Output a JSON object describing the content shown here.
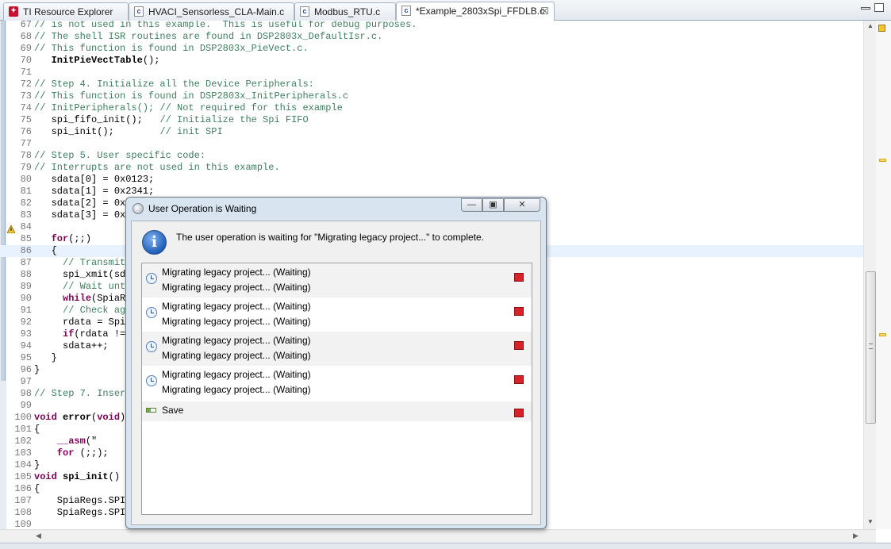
{
  "tabs": [
    {
      "icon": "ti-resource-explorer-icon",
      "label": "TI Resource Explorer"
    },
    {
      "icon": "c-file-icon",
      "label": "HVACI_Sensorless_CLA-Main.c"
    },
    {
      "icon": "c-file-icon",
      "label": "Modbus_RTU.c"
    },
    {
      "icon": "c-file-icon",
      "label": "*Example_2803xSpi_FFDLB.c",
      "active": true,
      "close": "☒"
    }
  ],
  "code_lines": [
    {
      "n": "67",
      "html": "<span class=\"c-com\">// is not used in this example.  This is useful for debug purposes.</span>"
    },
    {
      "n": "68",
      "html": "<span class=\"c-com\">// The shell ISR routines are found in DSP2803x_DefaultIsr.c.</span>"
    },
    {
      "n": "69",
      "html": "<span class=\"c-com\">// This function is found in DSP2803x_PieVect.c.</span>"
    },
    {
      "n": "70",
      "html": "   <span class=\"c-fn\">InitPieVectTable</span>();"
    },
    {
      "n": "71",
      "html": ""
    },
    {
      "n": "72",
      "html": "<span class=\"c-com\">// Step 4. Initialize all the Device Peripherals:</span>"
    },
    {
      "n": "73",
      "html": "<span class=\"c-com\">// This function is found in DSP2803x_InitPeripherals.c</span>"
    },
    {
      "n": "74",
      "html": "<span class=\"c-com\">// InitPeripherals(); // Not required for this example</span>"
    },
    {
      "n": "75",
      "html": "   spi_fifo_init();   <span class=\"c-com\">// Initialize the Spi FIFO</span>"
    },
    {
      "n": "76",
      "html": "   spi_init();        <span class=\"c-com\">// init SPI</span>"
    },
    {
      "n": "77",
      "html": ""
    },
    {
      "n": "78",
      "html": "<span class=\"c-com\">// Step 5. User specific code:</span>"
    },
    {
      "n": "79",
      "html": "<span class=\"c-com\">// Interrupts are not used in this example.</span>"
    },
    {
      "n": "80",
      "html": "   sdata[0] = 0x0123;"
    },
    {
      "n": "81",
      "html": "   sdata[1] = 0x2341;"
    },
    {
      "n": "82",
      "html": "   sdata[2] = 0x"
    },
    {
      "n": "83",
      "html": "   sdata[3] = 0x"
    },
    {
      "n": "84",
      "html": ""
    },
    {
      "n": "85",
      "html": "   <span class=\"c-kw\">for</span>(;;)"
    },
    {
      "n": "86",
      "html": "   {",
      "hl": true
    },
    {
      "n": "87",
      "html": "     <span class=\"c-com\">// Transmit</span>"
    },
    {
      "n": "88",
      "html": "     spi_xmit(sda"
    },
    {
      "n": "89",
      "html": "     <span class=\"c-com\">// Wait unti</span>"
    },
    {
      "n": "90",
      "html": "     <span class=\"c-kw\">while</span>(SpiaRe"
    },
    {
      "n": "91",
      "html": "     <span class=\"c-com\">// Check aga</span>"
    },
    {
      "n": "92",
      "html": "     rdata = Spia"
    },
    {
      "n": "93",
      "html": "     <span class=\"c-kw\">if</span>(rdata !="
    },
    {
      "n": "94",
      "html": "     sdata++;"
    },
    {
      "n": "95",
      "html": "   }"
    },
    {
      "n": "96",
      "html": "}"
    },
    {
      "n": "97",
      "html": ""
    },
    {
      "n": "98",
      "html": "<span class=\"c-com\">// Step 7. Insert</span>"
    },
    {
      "n": "99",
      "html": ""
    },
    {
      "n": "100",
      "html": "<span class=\"c-kw\">void</span> <span class=\"c-fn\">error</span>(<span class=\"c-kw\">void</span>)"
    },
    {
      "n": "101",
      "html": "{"
    },
    {
      "n": "102",
      "html": "    <span class=\"c-kw\">__asm</span>(\"     E"
    },
    {
      "n": "103",
      "html": "    <span class=\"c-kw\">for</span> (;;);"
    },
    {
      "n": "104",
      "html": "}"
    },
    {
      "n": "105",
      "html": "<span class=\"c-kw\">void</span> <span class=\"c-fn\">spi_init</span>()"
    },
    {
      "n": "106",
      "html": "{"
    },
    {
      "n": "107",
      "html": "    SpiaRegs.SPIC"
    },
    {
      "n": "108",
      "html": "    SpiaRegs.SPIC"
    },
    {
      "n": "109",
      "html": ""
    }
  ],
  "dialog": {
    "title": "User Operation is Waiting",
    "message": "The user operation is waiting for \"Migrating legacy project...\" to complete.",
    "info_icon": "i",
    "buttons": {
      "minimize": "—",
      "restore": "▣",
      "close": "✕"
    },
    "jobs": [
      {
        "line1": "Migrating legacy project... (Waiting)",
        "line2": "Migrating legacy project... (Waiting)"
      },
      {
        "line1": "Migrating legacy project... (Waiting)",
        "line2": "Migrating legacy project... (Waiting)"
      },
      {
        "line1": "Migrating legacy project... (Waiting)",
        "line2": "Migrating legacy project... (Waiting)"
      },
      {
        "line1": "Migrating legacy project... (Waiting)",
        "line2": "Migrating legacy project... (Waiting)"
      }
    ],
    "save_job": {
      "label": "Save"
    }
  },
  "scroll": {
    "up": "▲",
    "down": "▼",
    "left": "◀",
    "right": "▶"
  }
}
